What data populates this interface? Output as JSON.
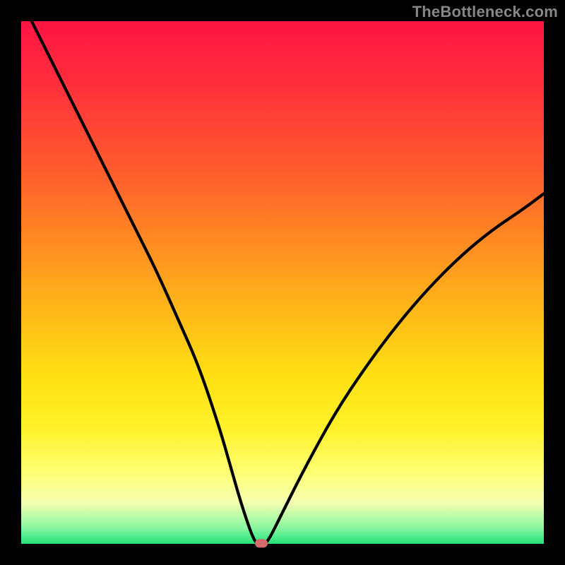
{
  "watermark": "TheBottleneck.com",
  "chart_data": {
    "type": "line",
    "title": "",
    "xlabel": "",
    "ylabel": "",
    "xlim": [
      0,
      100
    ],
    "ylim": [
      0,
      100
    ],
    "grid": false,
    "series": [
      {
        "name": "bottleneck-curve",
        "x": [
          2,
          6,
          10,
          14,
          18,
          22,
          26,
          30,
          34,
          38,
          40,
          42,
          44,
          45,
          46,
          47,
          50,
          54,
          60,
          66,
          72,
          78,
          84,
          90,
          96,
          100
        ],
        "values": [
          100,
          92,
          84,
          76,
          68,
          60,
          52,
          43,
          34,
          22,
          15,
          8,
          2,
          0,
          0,
          0,
          6,
          14,
          25,
          34,
          42,
          49,
          55,
          60,
          64,
          67
        ]
      }
    ],
    "marker": {
      "x": 46,
      "y": 0,
      "color": "#d46a6a"
    },
    "background_gradient": {
      "direction": "vertical",
      "stops": [
        {
          "pos": 0.0,
          "color": "#ff1444"
        },
        {
          "pos": 0.28,
          "color": "#ff5a2e"
        },
        {
          "pos": 0.56,
          "color": "#ffba18"
        },
        {
          "pos": 0.78,
          "color": "#fff22a"
        },
        {
          "pos": 0.92,
          "color": "#f6ffb0"
        },
        {
          "pos": 1.0,
          "color": "#24e27a"
        }
      ]
    }
  }
}
